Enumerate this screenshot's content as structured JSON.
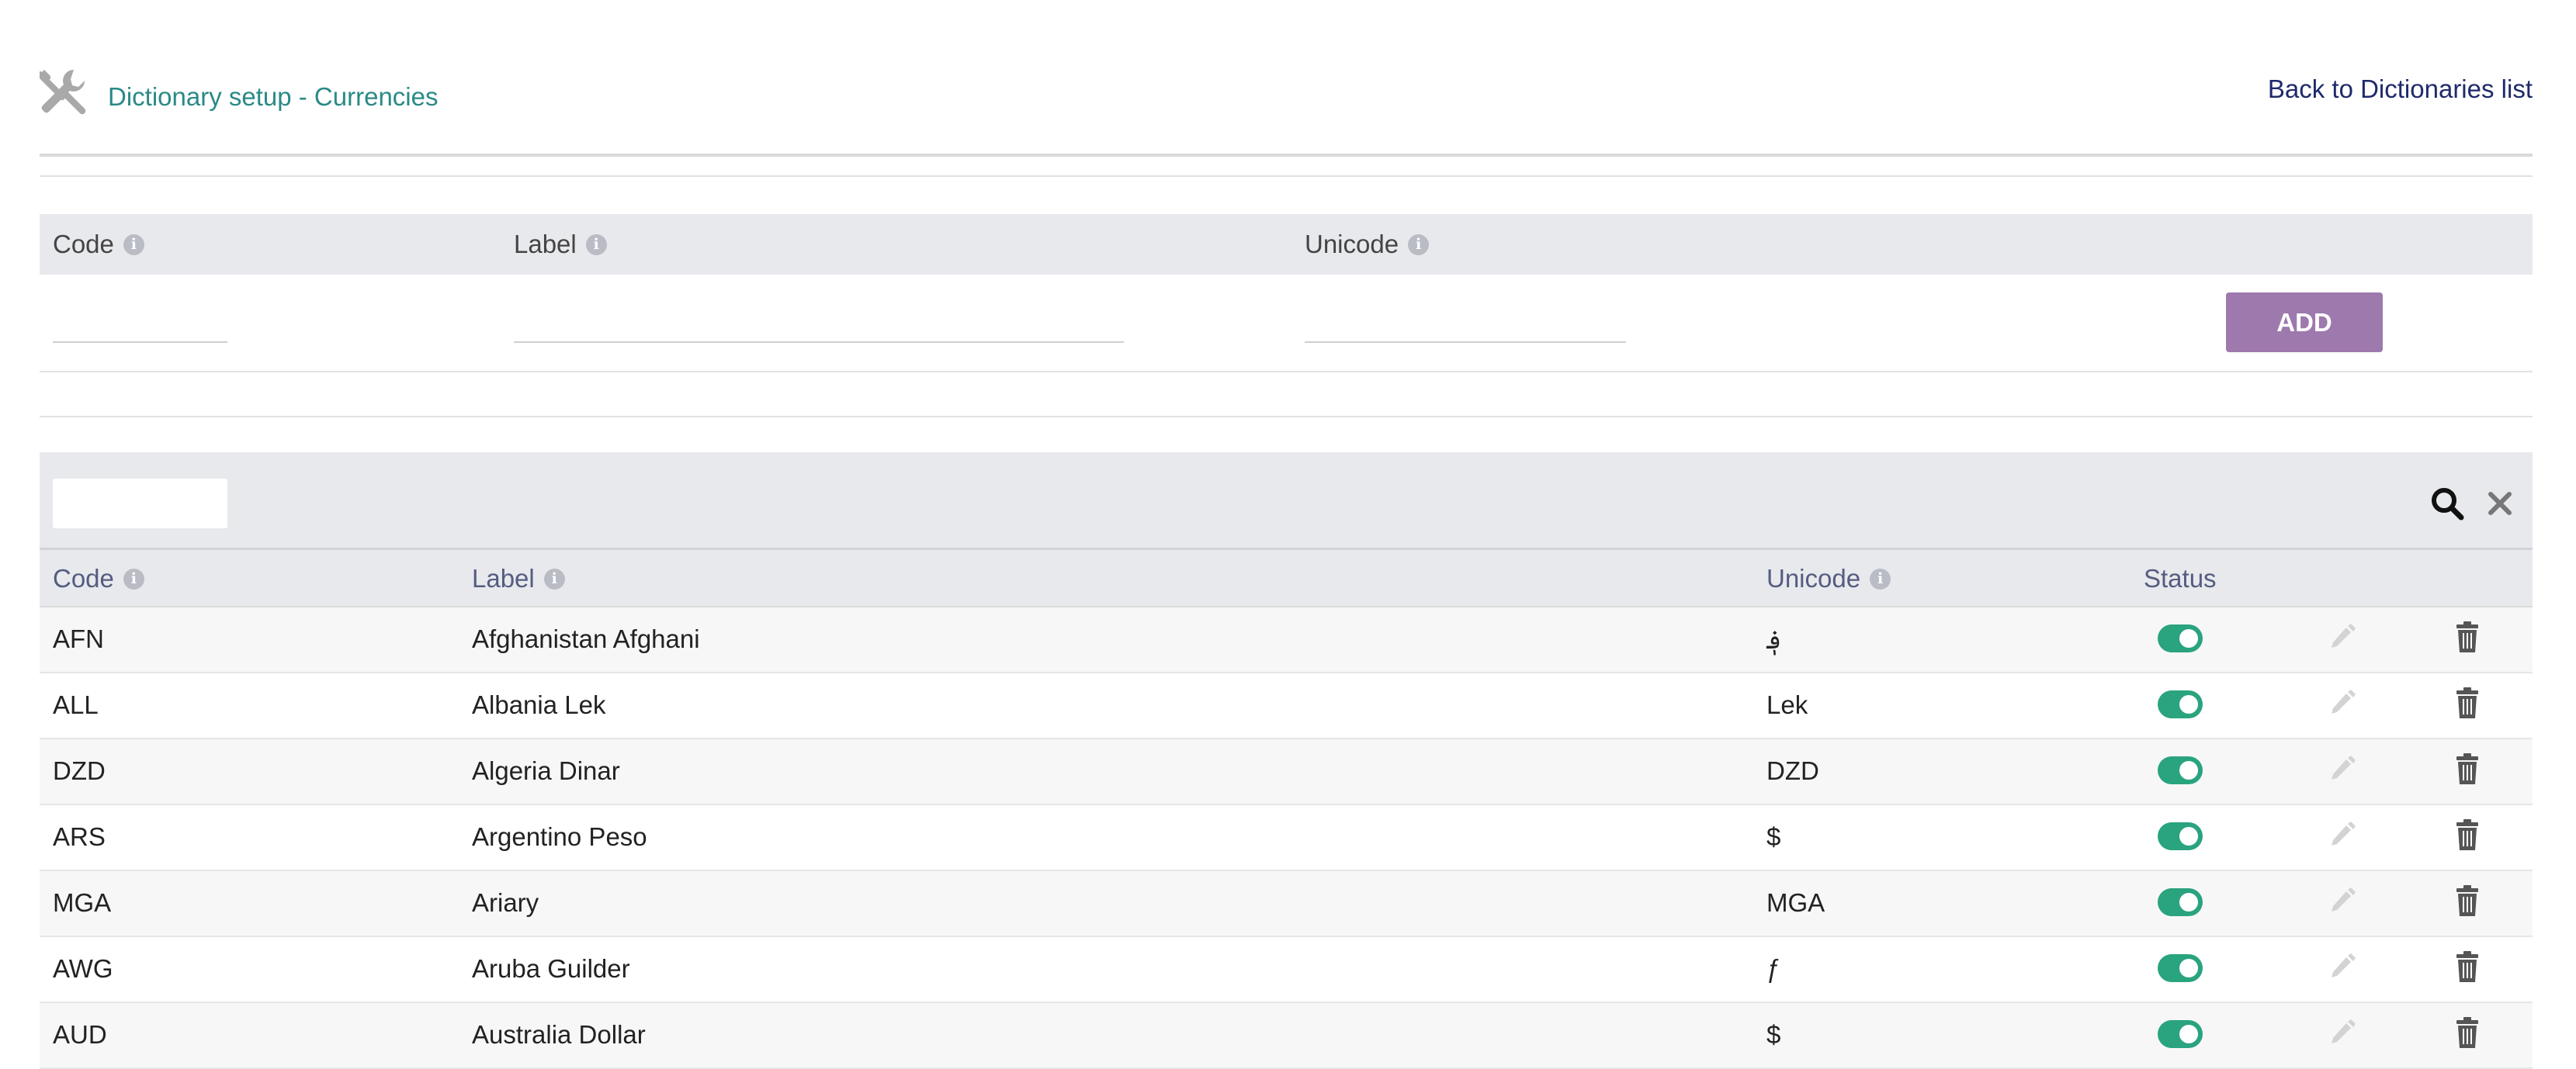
{
  "header": {
    "title": "Dictionary setup - Currencies",
    "back_link": "Back to Dictionaries list",
    "icon": "tools-icon"
  },
  "add_form": {
    "fields": [
      {
        "label": "Code",
        "value": ""
      },
      {
        "label": "Label",
        "value": ""
      },
      {
        "label": "Unicode",
        "value": ""
      }
    ],
    "add_button": "ADD"
  },
  "table": {
    "search": {
      "value": "",
      "placeholder": ""
    },
    "columns": [
      "Code",
      "Label",
      "Unicode",
      "Status"
    ],
    "rows": [
      {
        "code": "AFN",
        "label": "Afghanistan Afghani",
        "unicode": "؋",
        "status": true
      },
      {
        "code": "ALL",
        "label": "Albania Lek",
        "unicode": "Lek",
        "status": true
      },
      {
        "code": "DZD",
        "label": "Algeria Dinar",
        "unicode": "DZD",
        "status": true
      },
      {
        "code": "ARS",
        "label": "Argentino Peso",
        "unicode": "$",
        "status": true
      },
      {
        "code": "MGA",
        "label": "Ariary",
        "unicode": "MGA",
        "status": true
      },
      {
        "code": "AWG",
        "label": "Aruba Guilder",
        "unicode": "ƒ",
        "status": true
      },
      {
        "code": "AUD",
        "label": "Australia Dollar",
        "unicode": "$",
        "status": true
      }
    ]
  },
  "colors": {
    "title": "#2a8a86",
    "back_link": "#1f2a6b",
    "add_button": "#9d79ae",
    "toggle_on": "#2aa37f",
    "header_bg": "#e8e9ed"
  }
}
